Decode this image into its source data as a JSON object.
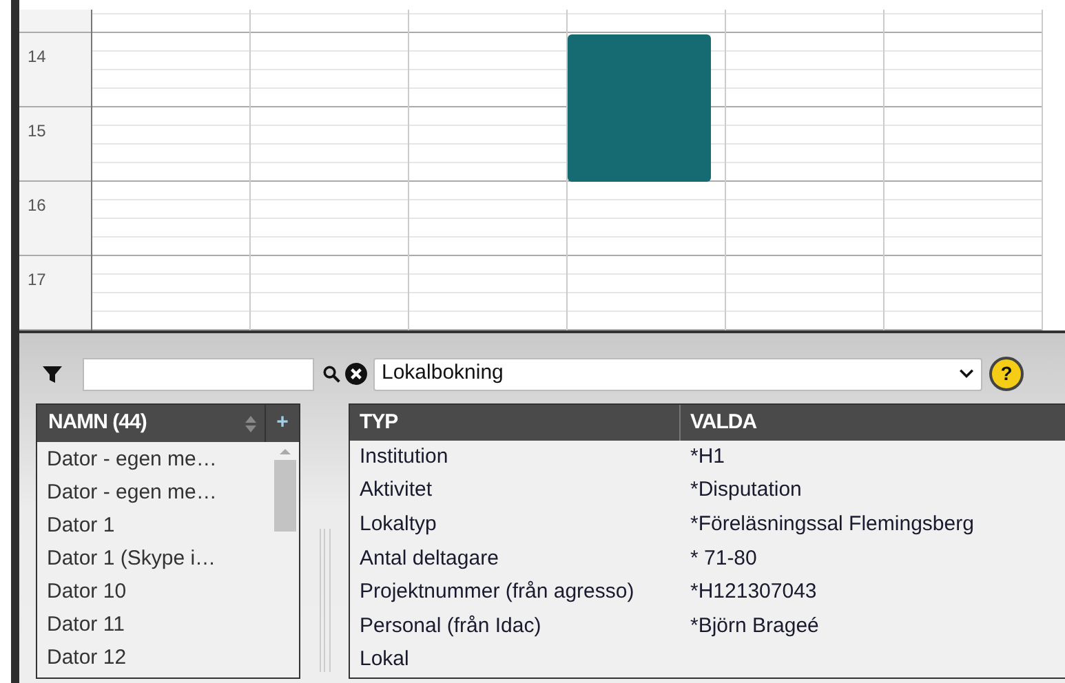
{
  "calendar": {
    "hours": [
      "14",
      "15",
      "16",
      "17"
    ],
    "events": [
      {
        "color": "#166b73"
      }
    ]
  },
  "filter": {
    "select_value": "Lokalbokning",
    "help_label": "?"
  },
  "names_list": {
    "header": "NAMN (44)",
    "add_label": "+",
    "items": [
      "Dator - egen me…",
      "Dator - egen me…",
      "Dator 1",
      "Dator 1 (Skype i…",
      "Dator 10",
      "Dator 11",
      "Dator 12"
    ]
  },
  "table": {
    "columns": [
      "TYP",
      "VALDA"
    ],
    "rows": [
      [
        "Institution",
        "*H1"
      ],
      [
        "Aktivitet",
        "*Disputation"
      ],
      [
        "Lokaltyp",
        "*Föreläsningssal Flemingsberg"
      ],
      [
        "Antal deltagare",
        "* 71-80"
      ],
      [
        "Projektnummer (från agresso)",
        "*H121307043"
      ],
      [
        "Personal (från Idac)",
        "*Björn Brageé"
      ],
      [
        "Lokal",
        ""
      ]
    ]
  }
}
